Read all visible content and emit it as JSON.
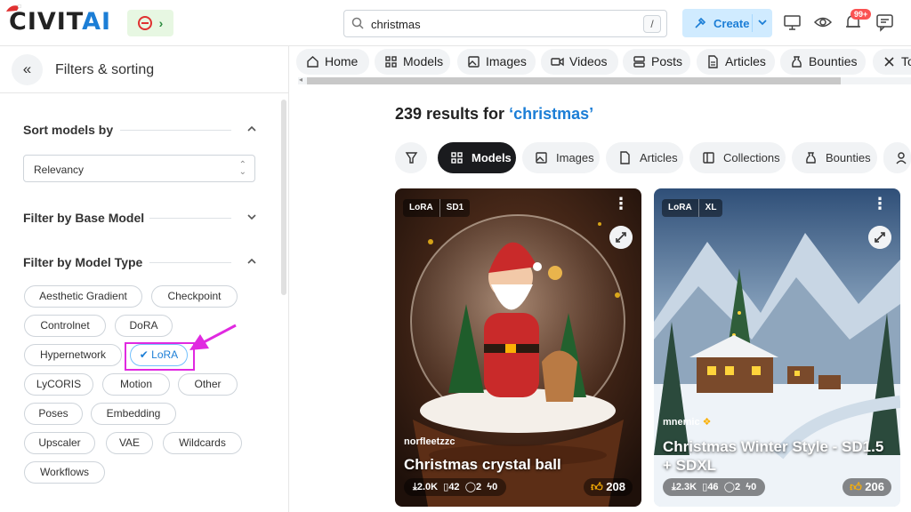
{
  "header": {
    "logo_main": "CIVIT",
    "logo_accent": "AI",
    "search": {
      "value": "christmas",
      "shortcut": "/"
    },
    "create_label": "Create",
    "notifications_badge": "99+"
  },
  "sidebar": {
    "title": "Filters & sorting",
    "sort_section": {
      "title": "Sort models by",
      "selected": "Relevancy"
    },
    "base_model_section": {
      "title": "Filter by Base Model"
    },
    "model_type_section": {
      "title": "Filter by Model Type",
      "chips": [
        "Aesthetic Gradient",
        "Checkpoint",
        "Controlnet",
        "DoRA",
        "Hypernetwork",
        "LoRA",
        "LyCORIS",
        "Motion",
        "Other",
        "Poses",
        "Embedding",
        "Upscaler",
        "VAE",
        "Wildcards",
        "Workflows"
      ],
      "selected_chip": "LoRA"
    }
  },
  "nav_tabs": [
    "Home",
    "Models",
    "Images",
    "Videos",
    "Posts",
    "Articles",
    "Bounties",
    "To"
  ],
  "results": {
    "count_text": "239 results for ",
    "query": "‘christmas’"
  },
  "filter_pills": [
    "Models",
    "Images",
    "Articles",
    "Collections",
    "Bounties"
  ],
  "cards": [
    {
      "type": "LoRA",
      "base": "SD1",
      "creator": "norfleetzzc",
      "title": "Christmas crystal ball",
      "downloads": "2.0K",
      "bookmarks": "42",
      "comments": "2",
      "buzz": "0",
      "likes": "208"
    },
    {
      "type": "LoRA",
      "base": "XL",
      "creator": "mnemic",
      "title": "Christmas Winter Style - SD1.5 + SDXL",
      "downloads": "2.3K",
      "bookmarks": "46",
      "comments": "2",
      "buzz": "0",
      "likes": "206"
    }
  ],
  "colors": {
    "accent": "#1c7ed6",
    "highlight": "#e029e0",
    "badge": "#fa5252"
  }
}
